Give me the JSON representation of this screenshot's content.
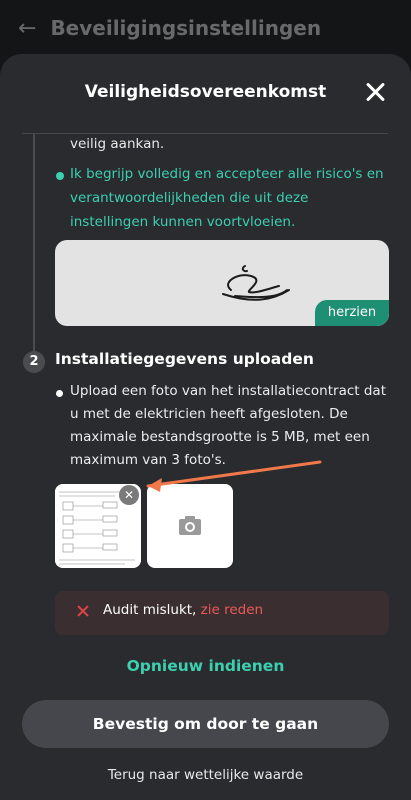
{
  "header": {
    "back_icon": "arrow-left-icon",
    "title": "Beveiligingsinstellingen"
  },
  "dialog": {
    "title": "Veiligheidsovereenkomst",
    "close_icon": "close-icon",
    "agreement_tail": "veilig aankan.",
    "acknowledgement": "Ik begrijp volledig en accepteer alle risico's en verantwoordelijkheden die uit deze instellingen kunnen voortvloeien.",
    "signature": {
      "review_label": "herzien"
    },
    "step2": {
      "number": "2",
      "title": "Installatiegegevens uploaden",
      "instruction": "Upload een foto van het installatiecontract dat u met de elektricien heeft afgesloten. De maximale bestandsgrootte is 5 MB, met een maximum van 3 foto's.",
      "remove_icon": "remove-photo-icon",
      "add_icon": "camera-icon"
    },
    "audit": {
      "message": "Audit mislukt,",
      "link": "zie reden",
      "icon": "error-x-icon",
      "color": "#e85a58"
    },
    "resubmit_label": "Opnieuw indienen",
    "confirm_label": "Bevestig om door te gaan",
    "back_legal_label": "Terug naar wettelijke waarde"
  },
  "colors": {
    "accent": "#3ccfb0",
    "error": "#e0454a",
    "sheet": "#2a2b2f"
  }
}
